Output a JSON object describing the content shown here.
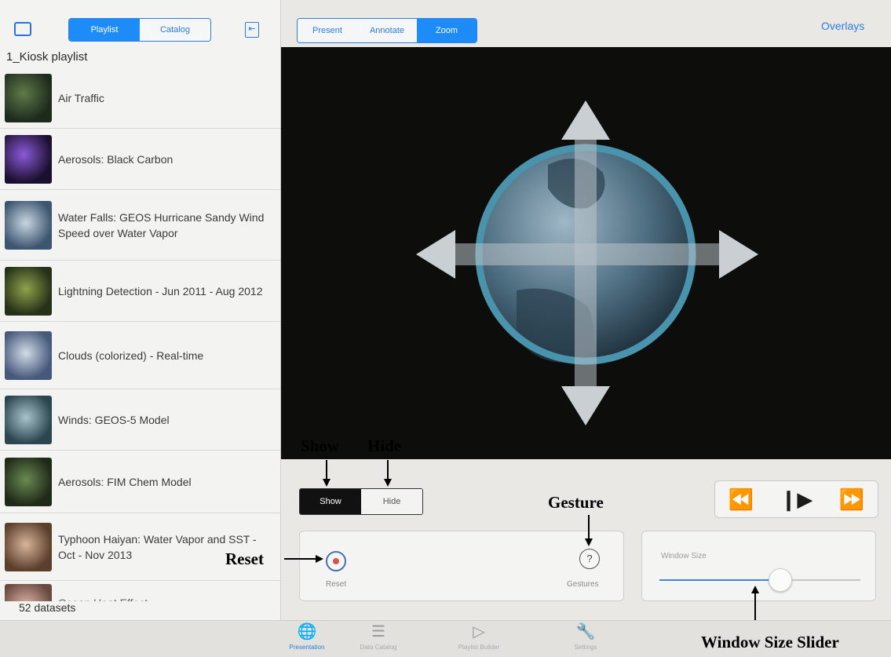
{
  "colors": {
    "accent": "#1d8cf8",
    "viewer_bg": "#0d0d0c",
    "globe_ring": "#4a93ad"
  },
  "left_toolbar": {
    "sidebar_icon": "sidebar-icon",
    "segments": [
      {
        "label": "Playlist",
        "selected": true
      },
      {
        "label": "Catalog",
        "selected": false
      }
    ],
    "collapse_icon": "collapse-icon"
  },
  "playlist": {
    "title": "1_Kiosk playlist",
    "items": [
      {
        "label": "Air Traffic",
        "thumb": "#2c3a2a"
      },
      {
        "label": "Aerosols: Black Carbon",
        "thumb": "#3a1f5e"
      },
      {
        "label": "Water Falls: GEOS Hurricane Sandy Wind Speed over Water Vapor",
        "thumb": "#4f6a86"
      },
      {
        "label": "Lightning Detection - Jun 2011 - Aug 2012",
        "thumb": "#3d4a2b"
      },
      {
        "label": "Clouds (colorized) - Real-time",
        "thumb": "#5e6f8e"
      },
      {
        "label": "Winds: GEOS-5 Model",
        "thumb": "#4a6470"
      },
      {
        "label": "Aerosols: FIM Chem Model",
        "thumb": "#2e3f27"
      },
      {
        "label": "Typhoon Haiyan: Water Vapor and SST - Oct - Nov 2013",
        "thumb": "#7a5c46"
      },
      {
        "label": "Ocean Heat Effect",
        "thumb": "#8a6a5e"
      }
    ],
    "count_text": "52 datasets"
  },
  "right_toolbar": {
    "modes": [
      {
        "label": "Present",
        "selected": false
      },
      {
        "label": "Annotate",
        "selected": false
      },
      {
        "label": "Zoom",
        "selected": true
      }
    ],
    "overlays_label": "Overlays"
  },
  "viewer": {
    "icon": "pan-zoom-gesture-icon"
  },
  "controls": {
    "show_hide": [
      {
        "label": "Show",
        "selected": true
      },
      {
        "label": "Hide",
        "selected": false
      }
    ],
    "playback_icons": [
      "rewind-icon",
      "step-play-icon",
      "fast-forward-icon"
    ],
    "reset_label": "Reset",
    "gestures_label": "Gestures",
    "window_size_label": "Window Size",
    "window_size_value": 0.6
  },
  "tab_bar": {
    "tabs": [
      {
        "label": "Presentation",
        "icon": "globe-icon",
        "selected": true
      },
      {
        "label": "Data Catalog",
        "icon": "list-icon",
        "selected": false
      },
      {
        "label": "Playlist Builder",
        "icon": "playlist-builder-icon",
        "selected": false
      },
      {
        "label": "Settings",
        "icon": "wrench-icon",
        "selected": false
      }
    ]
  },
  "annotations": {
    "show": "Show",
    "hide": "Hide",
    "gesture": "Gesture",
    "reset": "Reset",
    "window_size_slider": "Window Size Slider"
  }
}
